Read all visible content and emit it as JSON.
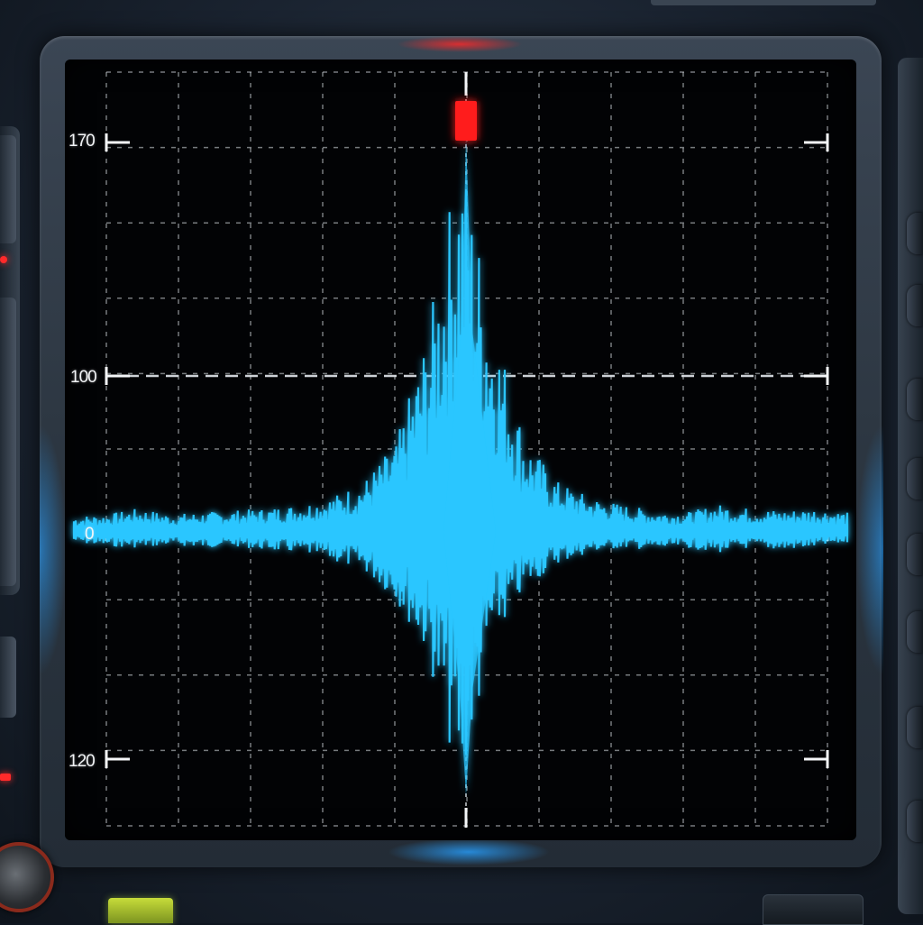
{
  "screen": {
    "trace_color": "#29c6ff",
    "grid_color": "#d8dde2",
    "marker_color": "#ff1a1a",
    "y_tick_labels": [
      "170",
      "100",
      "0",
      "120"
    ]
  },
  "chart_data": {
    "type": "line",
    "title": "",
    "xlabel": "",
    "ylabel": "",
    "grid": true,
    "y_ticks": [
      "170",
      "100",
      "0",
      "120"
    ],
    "series": [
      {
        "description_free": true,
        "envelope_upper": [
          40,
          45,
          60,
          45,
          50,
          55,
          60,
          70,
          90,
          130,
          230,
          520,
          1000,
          560,
          240,
          130,
          90,
          70,
          55,
          50,
          70,
          60,
          55,
          60,
          50
        ],
        "envelope_lower": [
          -40,
          -55,
          -60,
          -50,
          -60,
          -55,
          -70,
          -80,
          -110,
          -150,
          -260,
          -480,
          -1000,
          -420,
          -220,
          -120,
          -80,
          -60,
          -70,
          -60,
          -80,
          -60,
          -70,
          -60,
          -40
        ]
      }
    ],
    "peak_marker": true
  }
}
